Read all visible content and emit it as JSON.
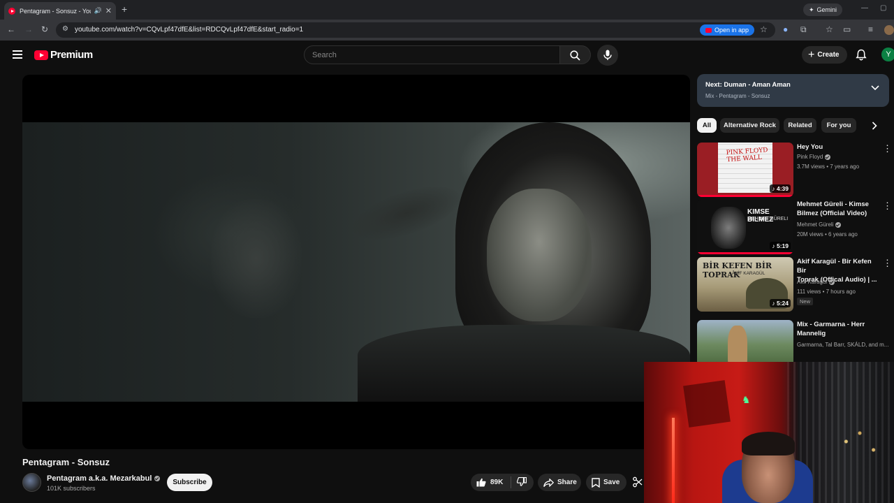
{
  "browser": {
    "tab_title": "Pentagram - Sonsuz - YouTube",
    "new_tab": "+",
    "gemini_label": "Gemini",
    "url": "youtube.com/watch?v=CQvLpf47dfE&list=RDCQvLpf47dfE&start_radio=1",
    "open_in_app": "Open in app"
  },
  "masthead": {
    "logo_text": "Premium",
    "search_placeholder": "Search",
    "create_label": "Create",
    "avatar_letter": "Y"
  },
  "video": {
    "title": "Pentagram - Sonsuz",
    "channel": "Pentagram a.k.a. Mezarkabul",
    "subscribers": "101K subscribers",
    "subscribe_label": "Subscribe",
    "likes": "89K",
    "share_label": "Share",
    "save_label": "Save"
  },
  "playlist": {
    "next_label": "Next: Duman - Aman Aman",
    "mix_subtitle": "Mix - Pentagram - Sonsuz"
  },
  "chips": [
    "All",
    "Alternative Rock",
    "Related",
    "For you"
  ],
  "recommendations": [
    {
      "title_line1": "Hey You",
      "title_line2": "",
      "channel": "Pink Floyd",
      "meta": "3.7M views • 7 years ago",
      "duration": "4:39",
      "thumb_text": "PINK FLOYD THE WALL",
      "badge": ""
    },
    {
      "title_line1": "Mehmet Güreli - Kimse",
      "title_line2": "Bilmez (Official Video)",
      "channel": "Mehmet Güreli",
      "meta": "20M views • 6 years ago",
      "duration": "5:19",
      "thumb_title": "KIMSE BILMEZ",
      "thumb_sub": "MEHMET GÜRELI",
      "badge": ""
    },
    {
      "title_line1": "Akif Karagül - Bir Kefen Bir",
      "title_line2": "Toprak (Offical Audio) | ...",
      "channel": "Âkif Karagül",
      "meta": "111 views • 7 hours ago",
      "duration": "5:24",
      "thumb_title": "BİR KEFEN BİR TOPRAK",
      "thumb_sub": "ÂKİF KARAGÜL",
      "badge": "New"
    },
    {
      "title_line1": "Mix - Garmarna - Herr",
      "title_line2": "Mannelig",
      "channel": "Garmarna, Tal Barr, SKÁLD, and m...",
      "meta": "",
      "duration": "",
      "badge": ""
    }
  ],
  "icons": {
    "speaker": "🔊",
    "close": "✕",
    "star": "☆",
    "more": "⋮",
    "chevron_right": "›",
    "sparkle": "✦"
  },
  "colors": {
    "brand_red": "#ff0033",
    "background": "#0f0f0f",
    "next_box": "#303a46"
  }
}
